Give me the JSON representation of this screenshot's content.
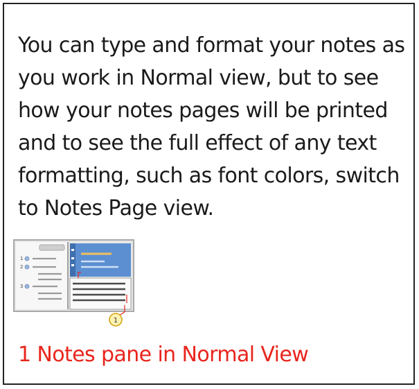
{
  "body_text": "You can type and format your notes as you work in Normal view, but to see how your notes pages will be printed and to see the full effect of any text formatting, such as font colors, switch to Notes Page view.",
  "thumbnail": {
    "icon": "normal-view-notes-pane-icon",
    "callout_number": "1",
    "accent_color": "#5b8fd1",
    "highlight_color": "#f2c05c",
    "callout_color": "#e8251c"
  },
  "caption": "1 Notes pane in Normal View"
}
